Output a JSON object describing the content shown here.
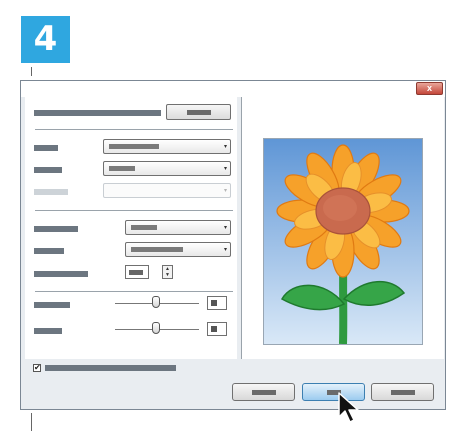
{
  "step": {
    "number": "4"
  },
  "dialog": {
    "close_label": "x",
    "checkbox_checked": "✔",
    "spin_up": "▲",
    "spin_down": "▼",
    "dropdown_arrow": "▾",
    "colors": {
      "accent": "#2fa7e0",
      "dialog_bg": "#e9edf1",
      "primary_button": "#9ccbef",
      "close_button": "#c4473a"
    },
    "icons": [
      "close-icon",
      "chevron-down-icon",
      "cursor-arrow-icon",
      "sunflower-image"
    ]
  }
}
